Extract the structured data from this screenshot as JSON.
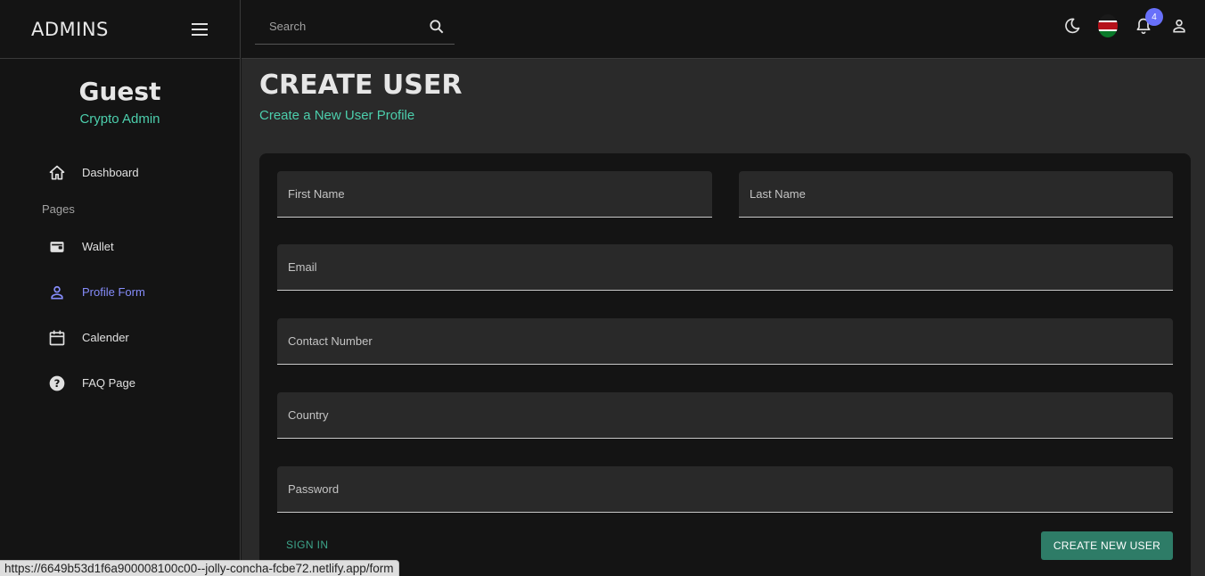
{
  "sidebar": {
    "brand": "ADMINS",
    "profile": {
      "name": "Guest",
      "role": "Crypto Admin"
    },
    "items": [
      {
        "label": "Dashboard",
        "icon": "home-icon"
      },
      {
        "label": "Wallet",
        "icon": "wallet-icon"
      },
      {
        "label": "Profile Form",
        "icon": "person-icon",
        "active": true
      },
      {
        "label": "Calender",
        "icon": "calendar-icon"
      },
      {
        "label": "FAQ Page",
        "icon": "help-icon"
      }
    ],
    "section_pages": "Pages"
  },
  "topbar": {
    "search_placeholder": "Search",
    "notification_count": "4",
    "icons": [
      "dark-mode-icon",
      "kenya-flag-icon",
      "notifications-icon",
      "person-icon"
    ]
  },
  "page": {
    "title": "CREATE USER",
    "subtitle": "Create a New User Profile"
  },
  "form": {
    "first_name": "First Name",
    "last_name": "Last Name",
    "email": "Email",
    "contact": "Contact Number",
    "country": "Country",
    "password": "Password",
    "sign_in": "SIGN IN",
    "create": "CREATE NEW USER"
  },
  "status_url": "https://6649b53d1f6a900008100c00--jolly-concha-fcbe72.netlify.app/form",
  "colors": {
    "accent_green": "#4cceac",
    "active_purple": "#868dfb",
    "button_green": "#2e7c67",
    "badge": "#6870fa"
  }
}
